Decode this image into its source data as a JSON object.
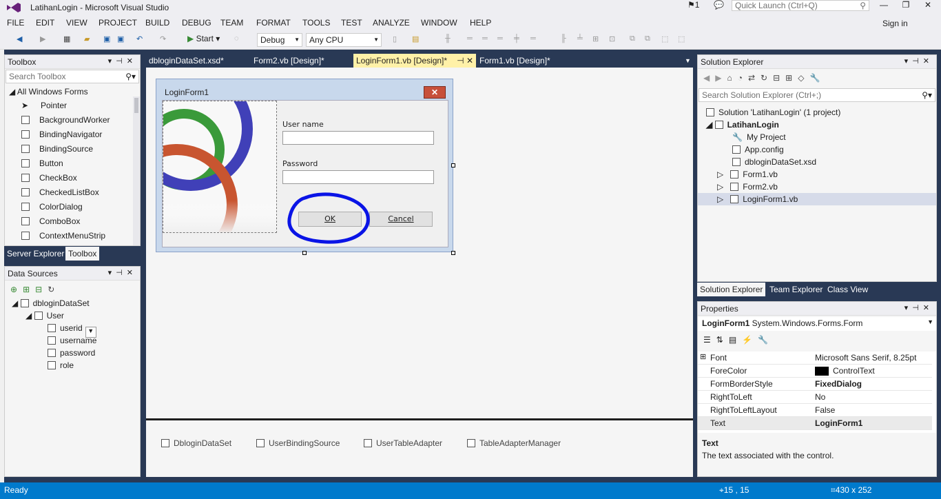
{
  "window": {
    "title": "LatihanLogin - Microsoft Visual Studio",
    "notification_count": "1",
    "quick_launch_placeholder": "Quick Launch (Ctrl+Q)",
    "sign_in": "Sign in"
  },
  "menu": [
    "FILE",
    "EDIT",
    "VIEW",
    "PROJECT",
    "BUILD",
    "DEBUG",
    "TEAM",
    "FORMAT",
    "TOOLS",
    "TEST",
    "ANALYZE",
    "WINDOW",
    "HELP"
  ],
  "toolbar": {
    "start_label": "Start",
    "config": "Debug",
    "platform": "Any CPU"
  },
  "toolbox": {
    "title": "Toolbox",
    "search_placeholder": "Search Toolbox",
    "group": "All Windows Forms",
    "items": [
      "Pointer",
      "BackgroundWorker",
      "BindingNavigator",
      "BindingSource",
      "Button",
      "CheckBox",
      "CheckedListBox",
      "ColorDialog",
      "ComboBox",
      "ContextMenuStrip"
    ],
    "tabs": [
      "Server Explorer",
      "Toolbox"
    ]
  },
  "data_sources": {
    "title": "Data Sources",
    "dataset": "dbloginDataSet",
    "table": "User",
    "fields": [
      "userid",
      "username",
      "password",
      "role"
    ]
  },
  "doc_tabs": [
    "dbloginDataSet.xsd*",
    "Form2.vb [Design]*",
    "LoginForm1.vb [Design]*",
    "Form1.vb [Design]*"
  ],
  "form": {
    "title": "LoginForm1",
    "username_label": "User name",
    "password_label": "Password",
    "ok_label": "OK",
    "cancel_label": "Cancel",
    "close_glyph": "✕"
  },
  "tray": [
    "DbloginDataSet",
    "UserBindingSource",
    "UserTableAdapter",
    "TableAdapterManager"
  ],
  "solution_explorer": {
    "title": "Solution Explorer",
    "search_placeholder": "Search Solution Explorer (Ctrl+;)",
    "solution": "Solution 'LatihanLogin' (1 project)",
    "project": "LatihanLogin",
    "items": [
      "My Project",
      "App.config",
      "dbloginDataSet.xsd",
      "Form1.vb",
      "Form2.vb",
      "LoginForm1.vb"
    ],
    "tabs": [
      "Solution Explorer",
      "Team Explorer",
      "Class View"
    ]
  },
  "properties": {
    "title": "Properties",
    "object": "LoginForm1",
    "object_type": "System.Windows.Forms.Form",
    "rows": [
      {
        "name": "Font",
        "value": "Microsoft Sans Serif, 8.25pt"
      },
      {
        "name": "ForeColor",
        "value": "ControlText"
      },
      {
        "name": "FormBorderStyle",
        "value": "FixedDialog"
      },
      {
        "name": "RightToLeft",
        "value": "No"
      },
      {
        "name": "RightToLeftLayout",
        "value": "False"
      },
      {
        "name": "Text",
        "value": "LoginForm1"
      }
    ],
    "desc_title": "Text",
    "desc_text": "The text associated with the control."
  },
  "status": {
    "text": "Ready",
    "position": "15 , 15",
    "size": "430 x 252"
  },
  "colors": {
    "status_bar": "#007acc",
    "annotation_circle": "#0a14e6",
    "active_tab": "#fff1a8"
  }
}
